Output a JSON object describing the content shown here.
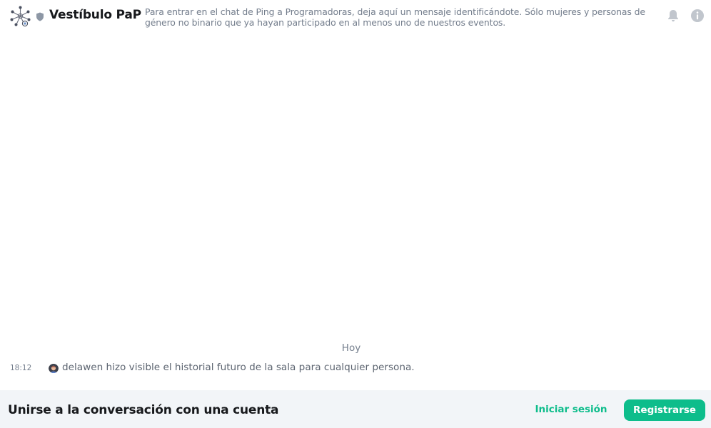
{
  "header": {
    "room_name": "Vestíbulo PaP",
    "topic": "Para entrar en el chat de Ping a Programadoras, deja aquí un mensaje identificándote. Sólo mujeres y personas de género no binario que ya hayan participado en al menos uno de nuestros eventos.",
    "icons": {
      "avatar": "network-logo-icon",
      "encryption": "shield-icon",
      "notifications": "bell-icon",
      "room_info": "info-icon"
    }
  },
  "timeline": {
    "date_separator": "Hoy",
    "events": [
      {
        "time": "18:12",
        "text": "delawen hizo visible el historial futuro de la sala para cualquier persona."
      }
    ]
  },
  "footer": {
    "title": "Unirse a la conversación con una cuenta",
    "login_label": "Iniciar sesión",
    "register_label": "Registrarse"
  },
  "colors": {
    "accent": "#0dbd8b",
    "secondary_text": "#737d8c",
    "footer_bg": "#f2f5f8",
    "shield": "#8d97a5"
  }
}
